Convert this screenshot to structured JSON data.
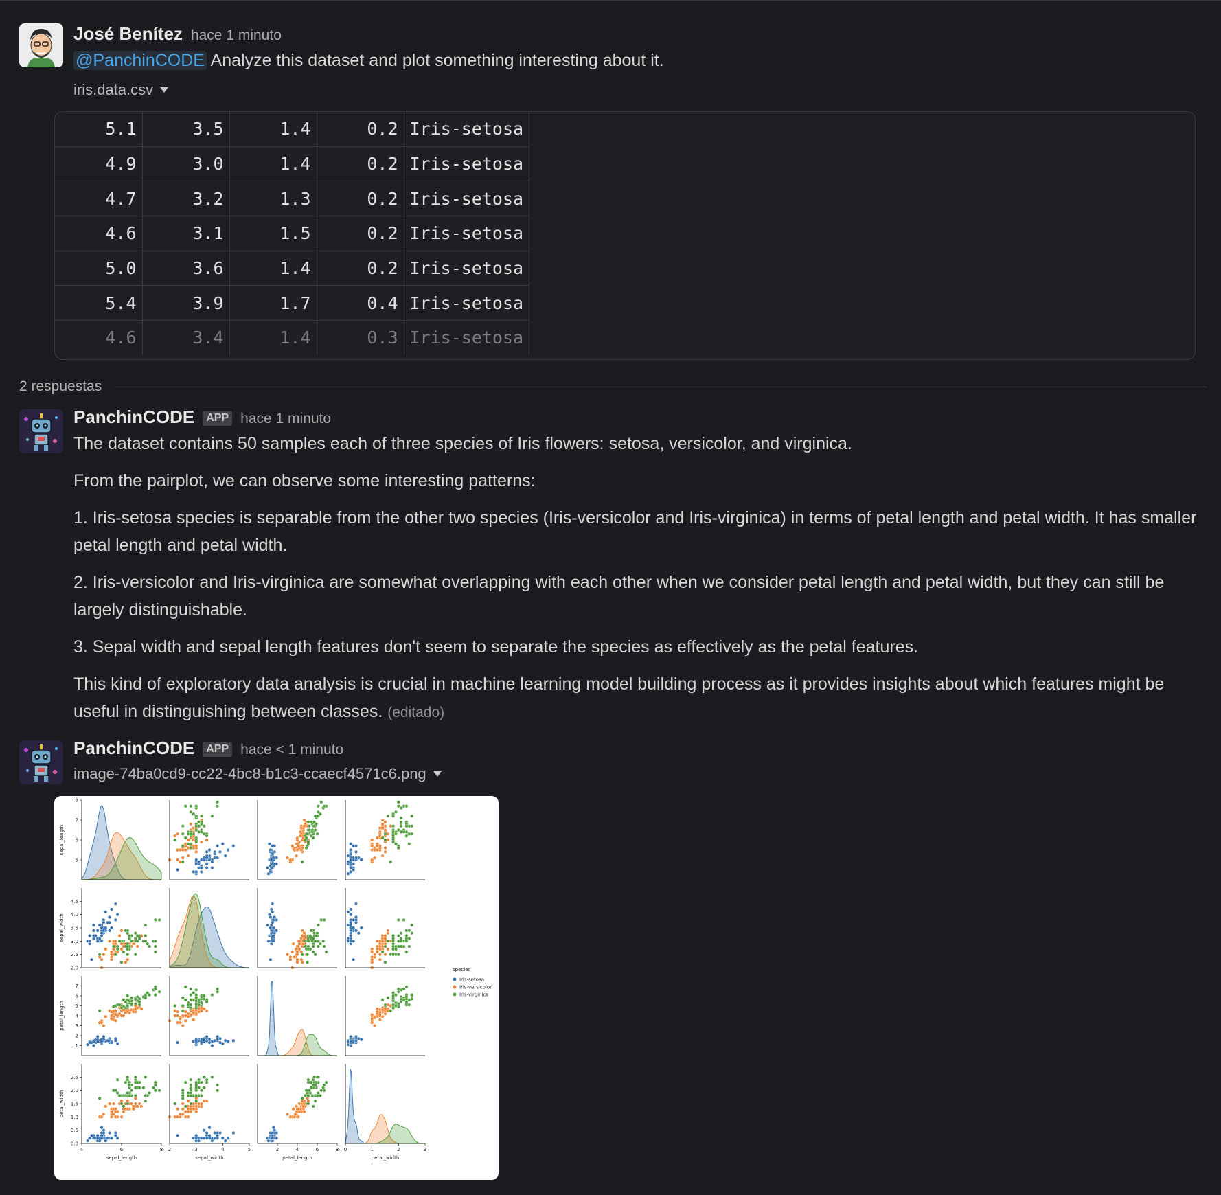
{
  "message1": {
    "author": "José Benítez",
    "time": "hace 1 minuto",
    "mention": "@PanchinCODE",
    "text": "Analyze this dataset and plot something interesting about it.",
    "file_name": "iris.data.csv",
    "csv_rows": [
      [
        "5.1",
        "3.5",
        "1.4",
        "0.2",
        "Iris-setosa"
      ],
      [
        "4.9",
        "3.0",
        "1.4",
        "0.2",
        "Iris-setosa"
      ],
      [
        "4.7",
        "3.2",
        "1.3",
        "0.2",
        "Iris-setosa"
      ],
      [
        "4.6",
        "3.1",
        "1.5",
        "0.2",
        "Iris-setosa"
      ],
      [
        "5.0",
        "3.6",
        "1.4",
        "0.2",
        "Iris-setosa"
      ],
      [
        "5.4",
        "3.9",
        "1.7",
        "0.4",
        "Iris-setosa"
      ],
      [
        "4.6",
        "3.4",
        "1.4",
        "0.3",
        "Iris-setosa"
      ]
    ]
  },
  "thread": {
    "replies_label": "2 respuestas"
  },
  "message2": {
    "author": "PanchinCODE",
    "app_tag": "APP",
    "time": "hace 1 minuto",
    "paragraphs": [
      "The dataset contains 50 samples each of three species of Iris flowers: setosa, versicolor, and virginica.",
      "From the pairplot, we can observe some interesting patterns:",
      "1. Iris-setosa species is separable from the other two species (Iris-versicolor and Iris-virginica) in terms of petal length and petal width. It has smaller petal length and petal width.",
      "2. Iris-versicolor and Iris-virginica are somewhat overlapping with each other when we consider petal length and petal width, but they can still be largely distinguishable.",
      "3. Sepal width and sepal length features don't seem to separate the species as effectively as the petal features.",
      "This kind of exploratory data analysis is crucial in machine learning model building process as it provides insights about which features might be useful in distinguishing between classes."
    ],
    "edited_label": "(editado)"
  },
  "message3": {
    "author": "PanchinCODE",
    "app_tag": "APP",
    "time": "hace < 1 minuto",
    "file_name": "image-74ba0cd9-cc22-4bc8-b1c3-ccaecf4571c6.png"
  },
  "colors": {
    "setosa": "#3b75af",
    "versicolor": "#ef8636",
    "virginica": "#519e3e",
    "mention": "#4aa4e6",
    "background": "#1b1c1f"
  },
  "chart_data": {
    "type": "scatter",
    "variables": [
      "sepal_length",
      "sepal_width",
      "petal_length",
      "petal_width"
    ],
    "axis_ranges": {
      "sepal_length": [
        4,
        8
      ],
      "sepal_width": [
        2,
        5
      ],
      "petal_length": [
        0,
        8
      ],
      "petal_width": [
        0,
        3
      ]
    },
    "ticks": {
      "sepal_length": {
        "y": [
          "5",
          "6",
          "7",
          "8"
        ],
        "x": [
          "4",
          "6",
          "8"
        ]
      },
      "sepal_width": {
        "y": [
          "2.0",
          "2.5",
          "3.0",
          "3.5",
          "4.0",
          "4.5"
        ],
        "x": [
          "2",
          "3",
          "4",
          "5"
        ]
      },
      "petal_length": {
        "y": [
          "1",
          "2",
          "3",
          "4",
          "5",
          "6",
          "7"
        ],
        "x": [
          "2",
          "4",
          "6",
          "8"
        ]
      },
      "petal_width": {
        "y": [
          "0.0",
          "0.5",
          "1.0",
          "1.5",
          "2.0",
          "2.5"
        ],
        "x": [
          "0",
          "1",
          "2",
          "3"
        ]
      }
    },
    "legend": {
      "title": "species",
      "placement": "right",
      "entries": [
        "Iris-setosa",
        "Iris-versicolor",
        "Iris-virginica"
      ]
    },
    "series": [
      {
        "name": "Iris-setosa",
        "sepal_length": [
          5.1,
          4.9,
          4.7,
          4.6,
          5.0,
          5.4,
          4.6,
          5.0,
          4.4,
          4.9,
          5.4,
          4.8,
          4.8,
          4.3,
          5.8,
          5.7,
          5.4,
          5.1,
          5.7,
          5.1,
          5.4,
          5.1,
          4.6,
          5.1,
          4.8,
          5.0,
          5.0,
          5.2,
          5.2,
          4.7,
          4.8,
          5.4,
          5.2,
          5.5,
          4.9,
          5.0,
          5.5,
          4.9,
          4.4,
          5.1,
          5.0,
          4.5,
          4.4,
          5.0,
          5.1,
          4.8,
          5.1,
          4.6,
          5.3,
          5.0
        ],
        "sepal_width": [
          3.5,
          3.0,
          3.2,
          3.1,
          3.6,
          3.9,
          3.4,
          3.4,
          2.9,
          3.1,
          3.7,
          3.4,
          3.0,
          3.0,
          4.0,
          4.4,
          3.9,
          3.5,
          3.8,
          3.8,
          3.4,
          3.7,
          3.6,
          3.3,
          3.4,
          3.0,
          3.4,
          3.5,
          3.4,
          3.2,
          3.1,
          3.4,
          4.1,
          4.2,
          3.1,
          3.2,
          3.5,
          3.6,
          3.0,
          3.4,
          3.5,
          2.3,
          3.2,
          3.5,
          3.8,
          3.0,
          3.8,
          3.2,
          3.7,
          3.3
        ],
        "petal_length": [
          1.4,
          1.4,
          1.3,
          1.5,
          1.4,
          1.7,
          1.4,
          1.5,
          1.4,
          1.5,
          1.5,
          1.6,
          1.4,
          1.1,
          1.2,
          1.5,
          1.3,
          1.4,
          1.7,
          1.5,
          1.7,
          1.5,
          1.0,
          1.7,
          1.9,
          1.6,
          1.6,
          1.5,
          1.4,
          1.6,
          1.6,
          1.5,
          1.5,
          1.4,
          1.5,
          1.2,
          1.3,
          1.4,
          1.3,
          1.5,
          1.3,
          1.3,
          1.3,
          1.6,
          1.9,
          1.4,
          1.6,
          1.4,
          1.5,
          1.4
        ],
        "petal_width": [
          0.2,
          0.2,
          0.2,
          0.2,
          0.2,
          0.4,
          0.3,
          0.2,
          0.2,
          0.1,
          0.2,
          0.2,
          0.1,
          0.1,
          0.2,
          0.4,
          0.4,
          0.3,
          0.3,
          0.3,
          0.2,
          0.4,
          0.2,
          0.5,
          0.2,
          0.2,
          0.4,
          0.2,
          0.2,
          0.2,
          0.2,
          0.4,
          0.1,
          0.2,
          0.2,
          0.2,
          0.2,
          0.1,
          0.2,
          0.2,
          0.3,
          0.3,
          0.2,
          0.6,
          0.4,
          0.3,
          0.2,
          0.2,
          0.2,
          0.2
        ]
      },
      {
        "name": "Iris-versicolor",
        "sepal_length": [
          7.0,
          6.4,
          6.9,
          5.5,
          6.5,
          5.7,
          6.3,
          4.9,
          6.6,
          5.2,
          5.0,
          5.9,
          6.0,
          6.1,
          5.6,
          6.7,
          5.6,
          5.8,
          6.2,
          5.6,
          5.9,
          6.1,
          6.3,
          6.1,
          6.4,
          6.6,
          6.8,
          6.7,
          6.0,
          5.7,
          5.5,
          5.5,
          5.8,
          6.0,
          5.4,
          6.0,
          6.7,
          6.3,
          5.6,
          5.5,
          5.5,
          6.1,
          5.8,
          5.0,
          5.6,
          5.7,
          5.7,
          6.2,
          5.1,
          5.7
        ],
        "sepal_width": [
          3.2,
          3.2,
          3.1,
          2.3,
          2.8,
          2.8,
          3.3,
          2.4,
          2.9,
          2.7,
          2.0,
          3.0,
          2.2,
          2.9,
          2.9,
          3.1,
          3.0,
          2.7,
          2.2,
          2.5,
          3.2,
          2.8,
          2.5,
          2.8,
          2.9,
          3.0,
          2.8,
          3.0,
          2.9,
          2.6,
          2.4,
          2.4,
          2.7,
          2.7,
          3.0,
          3.4,
          3.1,
          2.3,
          3.0,
          2.5,
          2.6,
          3.0,
          2.6,
          2.3,
          2.7,
          3.0,
          2.9,
          2.9,
          2.5,
          2.8
        ],
        "petal_length": [
          4.7,
          4.5,
          4.9,
          4.0,
          4.6,
          4.5,
          4.7,
          3.3,
          4.6,
          3.9,
          3.5,
          4.2,
          4.0,
          4.7,
          3.6,
          4.4,
          4.5,
          4.1,
          4.5,
          3.9,
          4.8,
          4.0,
          4.9,
          4.7,
          4.3,
          4.4,
          4.8,
          5.0,
          4.5,
          3.5,
          3.8,
          3.7,
          3.9,
          5.1,
          4.5,
          4.5,
          4.7,
          4.4,
          4.1,
          4.0,
          4.4,
          4.6,
          4.0,
          3.3,
          4.2,
          4.2,
          4.2,
          4.3,
          3.0,
          4.1
        ],
        "petal_width": [
          1.4,
          1.5,
          1.5,
          1.3,
          1.5,
          1.3,
          1.6,
          1.0,
          1.3,
          1.4,
          1.0,
          1.5,
          1.0,
          1.4,
          1.3,
          1.4,
          1.5,
          1.0,
          1.5,
          1.1,
          1.8,
          1.3,
          1.5,
          1.2,
          1.3,
          1.4,
          1.4,
          1.7,
          1.5,
          1.0,
          1.1,
          1.0,
          1.2,
          1.6,
          1.5,
          1.6,
          1.5,
          1.3,
          1.3,
          1.3,
          1.2,
          1.4,
          1.2,
          1.0,
          1.3,
          1.2,
          1.3,
          1.3,
          1.1,
          1.3
        ]
      },
      {
        "name": "Iris-virginica",
        "sepal_length": [
          6.3,
          5.8,
          7.1,
          6.3,
          6.5,
          7.6,
          4.9,
          7.3,
          6.7,
          7.2,
          6.5,
          6.4,
          6.8,
          5.7,
          5.8,
          6.4,
          6.5,
          7.7,
          7.7,
          6.0,
          6.9,
          5.6,
          7.7,
          6.3,
          6.7,
          7.2,
          6.2,
          6.1,
          6.4,
          7.2,
          7.4,
          7.9,
          6.4,
          6.3,
          6.1,
          7.7,
          6.3,
          6.4,
          6.0,
          6.9,
          6.7,
          6.9,
          5.8,
          6.8,
          6.7,
          6.7,
          6.3,
          6.5,
          6.2,
          5.9
        ],
        "sepal_width": [
          3.3,
          2.7,
          3.0,
          2.9,
          3.0,
          3.0,
          2.5,
          2.9,
          2.5,
          3.6,
          3.2,
          2.7,
          3.0,
          2.5,
          2.8,
          3.2,
          3.0,
          3.8,
          2.6,
          2.2,
          3.2,
          2.8,
          2.8,
          2.7,
          3.3,
          3.2,
          2.8,
          3.0,
          2.8,
          3.0,
          2.8,
          3.8,
          2.8,
          2.8,
          2.6,
          3.0,
          3.4,
          3.1,
          3.0,
          3.1,
          3.1,
          3.1,
          2.7,
          3.2,
          3.3,
          3.0,
          2.5,
          3.0,
          3.4,
          3.0
        ],
        "petal_length": [
          6.0,
          5.1,
          5.9,
          5.6,
          5.8,
          6.6,
          4.5,
          6.3,
          5.8,
          6.1,
          5.1,
          5.3,
          5.5,
          5.0,
          5.1,
          5.3,
          5.5,
          6.7,
          6.9,
          5.0,
          5.7,
          4.9,
          6.7,
          4.9,
          5.7,
          6.0,
          4.8,
          4.9,
          5.6,
          5.8,
          6.1,
          6.4,
          5.6,
          5.1,
          5.6,
          6.1,
          5.6,
          5.5,
          4.8,
          5.4,
          5.6,
          5.1,
          5.1,
          5.9,
          5.7,
          5.2,
          5.0,
          5.2,
          5.4,
          5.1
        ],
        "petal_width": [
          2.5,
          1.9,
          2.1,
          1.8,
          2.2,
          2.1,
          1.7,
          1.8,
          1.8,
          2.5,
          2.0,
          1.9,
          2.1,
          2.0,
          2.4,
          2.3,
          1.8,
          2.2,
          2.3,
          1.5,
          2.3,
          2.0,
          2.0,
          1.8,
          2.1,
          1.8,
          1.8,
          1.8,
          2.1,
          1.6,
          1.9,
          2.0,
          2.2,
          1.5,
          1.4,
          2.3,
          2.4,
          1.8,
          1.8,
          2.1,
          2.4,
          2.3,
          1.9,
          2.3,
          2.5,
          2.3,
          1.9,
          2.0,
          2.3,
          1.8
        ]
      }
    ]
  }
}
